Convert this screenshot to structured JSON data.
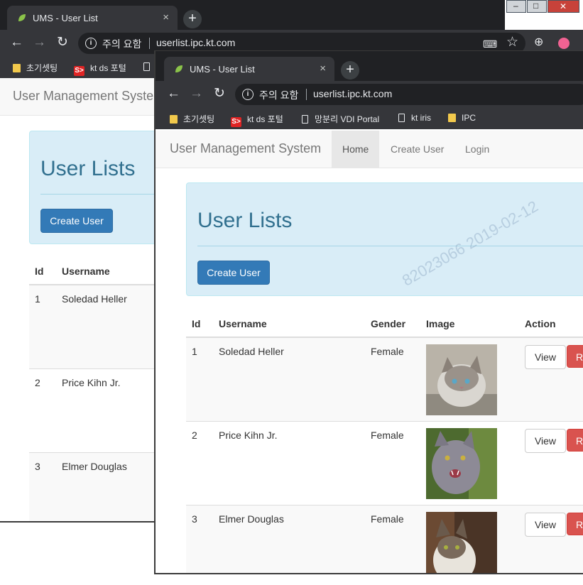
{
  "back_window": {
    "tab_title": "UMS - User List",
    "tab_close": "×",
    "new_tab": "+",
    "nav": {
      "back": "←",
      "forward": "→",
      "reload": "↻"
    },
    "address": {
      "info": "i",
      "warning": "주의 요함",
      "url": "userlist.ipc.kt.com"
    },
    "toolbar_icons": {
      "translate": "⌨",
      "star": "☆",
      "extension": "⊕"
    },
    "bookmarks": [
      "초기셋팅",
      "kt ds 포털"
    ],
    "brand": "User Management Syste",
    "jumbotron": {
      "title": "User Lists",
      "button": "Create User"
    },
    "table": {
      "headers": [
        "Id",
        "Username"
      ],
      "rows": [
        {
          "id": "1",
          "username": "Soledad Heller"
        },
        {
          "id": "2",
          "username": "Price Kihn Jr."
        },
        {
          "id": "3",
          "username": "Elmer Douglas"
        }
      ]
    }
  },
  "front_window": {
    "tab_title": "UMS - User List",
    "tab_close": "×",
    "new_tab": "+",
    "nav": {
      "back": "←",
      "forward": "→",
      "reload": "↻"
    },
    "address": {
      "info": "i",
      "warning": "주의 요함",
      "url": "userlist.ipc.kt.com"
    },
    "bookmarks": [
      {
        "label": "초기셋팅",
        "icon": "folder-icon"
      },
      {
        "label": "kt ds 포털",
        "icon": "sds-icon",
        "badge": "S>"
      },
      {
        "label": "망분리 VDI Portal",
        "icon": "page-icon"
      },
      {
        "label": "kt iris",
        "icon": "page-icon"
      },
      {
        "label": "IPC",
        "icon": "folder-icon"
      }
    ],
    "brand": "User Management System",
    "menu": [
      "Home",
      "Create User",
      "Login"
    ],
    "active_menu": "Home",
    "jumbotron": {
      "title": "User Lists",
      "button": "Create User"
    },
    "watermark": "82023066  2019-02-12",
    "table": {
      "headers": [
        "Id",
        "Username",
        "Gender",
        "Image",
        "Action"
      ],
      "rows": [
        {
          "id": "1",
          "username": "Soledad Heller",
          "gender": "Female",
          "view": "View",
          "r": "R"
        },
        {
          "id": "2",
          "username": "Price Kihn Jr.",
          "gender": "Female",
          "view": "View",
          "r": "R"
        },
        {
          "id": "3",
          "username": "Elmer Douglas",
          "gender": "Female",
          "view": "View",
          "r": "R"
        }
      ]
    }
  },
  "window_controls": {
    "minimize": "‒",
    "maximize": "□",
    "close": "✕"
  },
  "colors": {
    "primary": "#337ab7",
    "danger": "#d9534f",
    "jumbotron": "#d9edf7",
    "chrome_dark": "#202124"
  }
}
